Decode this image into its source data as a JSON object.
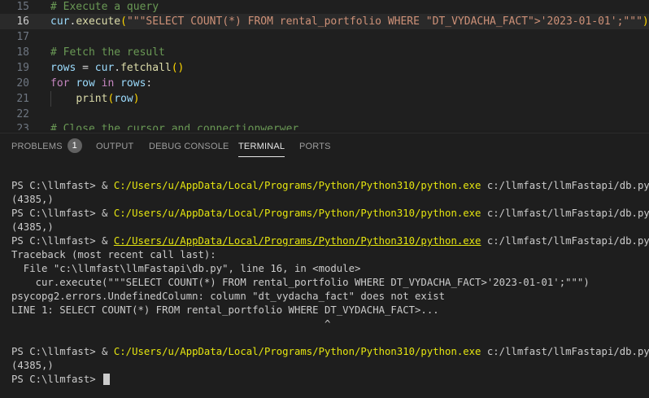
{
  "editor": {
    "lines": [
      {
        "num": "15",
        "segments": [
          {
            "cls": "c-com",
            "text": "# Execute a query"
          }
        ]
      },
      {
        "num": "16",
        "active": true,
        "segments": [
          {
            "cls": "c-var",
            "text": "cur"
          },
          {
            "cls": "c-plain",
            "text": "."
          },
          {
            "cls": "c-fn",
            "text": "execute"
          },
          {
            "cls": "c-br1",
            "text": "("
          },
          {
            "cls": "c-str",
            "text": "\"\"\"SELECT COUNT(*) FROM rental_portfolio WHERE \"DT_VYDACHA_FACT\">'2023-01-01';\"\"\""
          },
          {
            "cls": "c-br1",
            "text": ")"
          }
        ]
      },
      {
        "num": "17",
        "segments": []
      },
      {
        "num": "18",
        "segments": [
          {
            "cls": "c-com",
            "text": "# Fetch the result"
          }
        ]
      },
      {
        "num": "19",
        "segments": [
          {
            "cls": "c-var",
            "text": "rows"
          },
          {
            "cls": "c-plain",
            "text": " = "
          },
          {
            "cls": "c-var",
            "text": "cur"
          },
          {
            "cls": "c-plain",
            "text": "."
          },
          {
            "cls": "c-fn",
            "text": "fetchall"
          },
          {
            "cls": "c-br1",
            "text": "()"
          }
        ]
      },
      {
        "num": "20",
        "segments": [
          {
            "cls": "c-kw",
            "text": "for"
          },
          {
            "cls": "c-plain",
            "text": " "
          },
          {
            "cls": "c-var",
            "text": "row"
          },
          {
            "cls": "c-plain",
            "text": " "
          },
          {
            "cls": "c-kw",
            "text": "in"
          },
          {
            "cls": "c-plain",
            "text": " "
          },
          {
            "cls": "c-var",
            "text": "rows"
          },
          {
            "cls": "c-plain",
            "text": ":"
          }
        ]
      },
      {
        "num": "21",
        "indent": true,
        "segments": [
          {
            "cls": "c-plain",
            "text": "    "
          },
          {
            "cls": "c-fn",
            "text": "print"
          },
          {
            "cls": "c-br1",
            "text": "("
          },
          {
            "cls": "c-var",
            "text": "row"
          },
          {
            "cls": "c-br1",
            "text": ")"
          }
        ]
      },
      {
        "num": "22",
        "segments": []
      },
      {
        "num": "23",
        "segments": [
          {
            "cls": "c-com",
            "text": "# Close the cursor and connectionwerwer"
          }
        ]
      }
    ]
  },
  "panel": {
    "tabs": [
      {
        "name": "tab-problems",
        "label": "PROBLEMS",
        "badge": "1"
      },
      {
        "name": "tab-output",
        "label": "OUTPUT"
      },
      {
        "name": "tab-debug-console",
        "label": "DEBUG CONSOLE"
      },
      {
        "name": "tab-terminal",
        "label": "TERMINAL",
        "active": true
      },
      {
        "name": "tab-ports",
        "label": "PORTS"
      }
    ]
  },
  "terminal": {
    "lines": [
      [
        {
          "t": "PS C:\\llmfast> & "
        },
        {
          "t": "C:/Users/u/AppData/Local/Programs/Python/Python310/python.exe",
          "cls": "t-path"
        },
        {
          "t": " c:/llmfast/llmFastapi/db.py"
        }
      ],
      [
        {
          "t": "(4385,)"
        }
      ],
      [
        {
          "t": "PS C:\\llmfast> & "
        },
        {
          "t": "C:/Users/u/AppData/Local/Programs/Python/Python310/python.exe",
          "cls": "t-path"
        },
        {
          "t": " c:/llmfast/llmFastapi/db.py"
        }
      ],
      [
        {
          "t": "(4385,)"
        }
      ],
      [
        {
          "t": "PS C:\\llmfast> & "
        },
        {
          "t": "C:/Users/u/AppData/Local/Programs/Python/Python310/python.exe",
          "cls": "t-path t-link"
        },
        {
          "t": " c:/llmfast/llmFastapi/db.py"
        }
      ],
      [
        {
          "t": "Traceback (most recent call last):"
        }
      ],
      [
        {
          "t": "  File \"c:\\llmfast\\llmFastapi\\db.py\", line 16, in <module>"
        }
      ],
      [
        {
          "t": "    cur.execute(\"\"\"SELECT COUNT(*) FROM rental_portfolio WHERE DT_VYDACHA_FACT>'2023-01-01';\"\"\")"
        }
      ],
      [
        {
          "t": "psycopg2.errors.UndefinedColumn: column \"dt_vydacha_fact\" does not exist"
        }
      ],
      [
        {
          "t": "LINE 1: SELECT COUNT(*) FROM rental_portfolio WHERE DT_VYDACHA_FACT>..."
        }
      ],
      [
        {
          "t": "                                                    ^"
        }
      ],
      [
        {
          "t": ""
        }
      ],
      [
        {
          "t": "PS C:\\llmfast> & "
        },
        {
          "t": "C:/Users/u/AppData/Local/Programs/Python/Python310/python.exe",
          "cls": "t-path"
        },
        {
          "t": " c:/llmfast/llmFastapi/db.py"
        }
      ],
      [
        {
          "t": "(4385,)"
        }
      ],
      [
        {
          "t": "PS C:\\llmfast> "
        }
      ]
    ]
  }
}
